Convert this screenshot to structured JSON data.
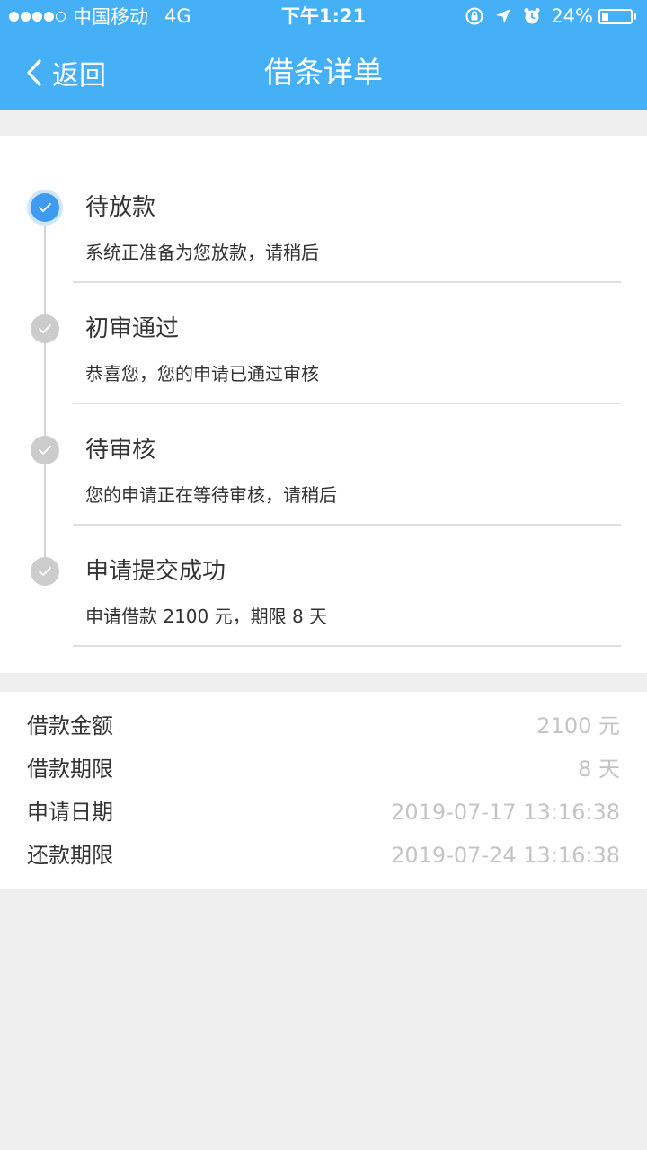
{
  "status_bar": {
    "carrier": "中国移动",
    "network": "4G",
    "time": "下午1:21",
    "battery_percent": "24%",
    "battery_level": 0.24,
    "signal_bars_filled": 4,
    "signal_bars_total": 5,
    "icons": [
      "orientation-lock-icon",
      "location-arrow-icon",
      "alarm-icon",
      "battery-icon"
    ]
  },
  "nav": {
    "back_label": "返回",
    "title": "借条详单",
    "back_icon": "chevron-left-icon"
  },
  "timeline": {
    "steps": [
      {
        "title": "待放款",
        "desc": "系统正准备为您放款，请稍后",
        "active": true
      },
      {
        "title": "初审通过",
        "desc": "恭喜您，您的申请已通过审核",
        "active": false
      },
      {
        "title": "待审核",
        "desc": "您的申请正在等待审核，请稍后",
        "active": false
      },
      {
        "title": "申请提交成功",
        "desc": "申请借款 2100 元，期限 8 天",
        "active": false
      }
    ],
    "step_icon": "check-icon"
  },
  "details": [
    {
      "label": "借款金额",
      "value": "2100 元"
    },
    {
      "label": "借款期限",
      "value": "8 天"
    },
    {
      "label": "申请日期",
      "value": "2019-07-17 13:16:38"
    },
    {
      "label": "还款期限",
      "value": "2019-07-24 13:16:38"
    }
  ],
  "colors": {
    "header_bg": "#45b0f5",
    "active_step": "#3f9bf0",
    "inactive_step": "#cccccc",
    "page_bg": "#efefef",
    "value_text": "#c4c4c4"
  }
}
